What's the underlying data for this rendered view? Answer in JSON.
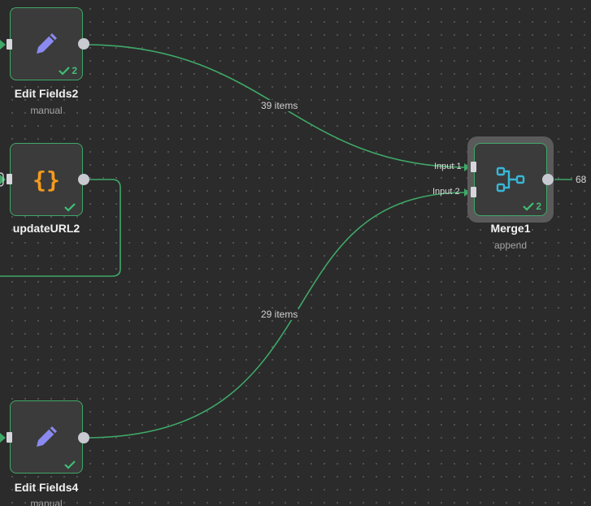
{
  "nodes": {
    "edit_fields2": {
      "title": "Edit Fields2",
      "subtitle": "manual",
      "run_count": "2",
      "icon": "pencil-icon"
    },
    "update_url2": {
      "title": "updateURL2",
      "subtitle": "",
      "run_count": "",
      "icon": "braces-icon"
    },
    "edit_fields4": {
      "title": "Edit Fields4",
      "subtitle": "manual",
      "run_count": "",
      "icon": "pencil-icon"
    },
    "merge1": {
      "title": "Merge1",
      "subtitle": "append",
      "run_count": "2",
      "icon": "merge-icon",
      "input1_label": "Input 1",
      "input2_label": "Input 2"
    }
  },
  "edges": {
    "edit_fields2_to_merge": "39 items",
    "edit_fields4_to_merge": "29 items",
    "merge_out": "68"
  },
  "colors": {
    "success": "#3fbf75",
    "edge": "#3fa868",
    "pencil": "#8a8af0",
    "braces": "#f59a1d",
    "merge": "#37b7d8"
  }
}
